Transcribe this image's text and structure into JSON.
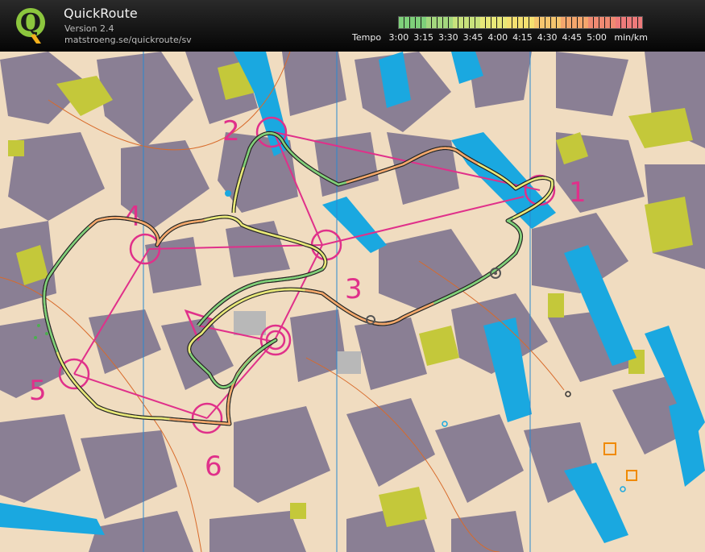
{
  "app": {
    "title": "QuickRoute",
    "version": "Version 2.4",
    "website": "matstroeng.se/quickroute/sv"
  },
  "logo": {
    "letter": "Q",
    "icon": "quickroute-logo-icon"
  },
  "pace_scale": {
    "label": "Tempo",
    "unit": "min/km",
    "ticks": [
      "3:00",
      "3:15",
      "3:30",
      "3:45",
      "4:00",
      "4:15",
      "4:30",
      "4:45",
      "5:00"
    ],
    "colors": [
      "#7ed07a",
      "#a4d87e",
      "#c8e27c",
      "#e8e878",
      "#f4e070",
      "#f5c66e",
      "#f4a66c",
      "#f08a72",
      "#ee7a7a"
    ]
  },
  "map": {
    "controls": [
      {
        "number": "1"
      },
      {
        "number": "2"
      },
      {
        "number": "3"
      },
      {
        "number": "4"
      },
      {
        "number": "5"
      },
      {
        "number": "6"
      }
    ],
    "colors": {
      "background": "#f0dcc0",
      "building": "#8a7f94",
      "water": "#1aa8e0",
      "green": "#c4c83a",
      "course": "#e0308a",
      "route_outline": "#222222"
    }
  }
}
